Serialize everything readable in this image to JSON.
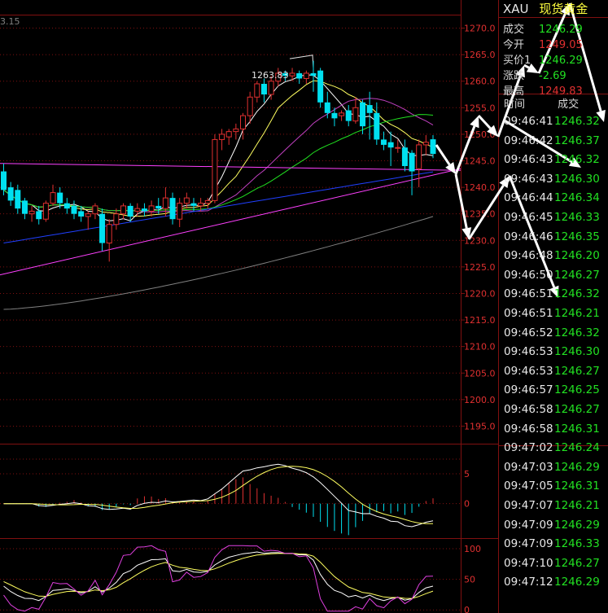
{
  "header": {
    "symbol": "XAU",
    "name": "现货黄金",
    "left_value": "3.15"
  },
  "quote": [
    {
      "label": "成交",
      "value": "1246.29",
      "color": "#22e022"
    },
    {
      "label": "今开",
      "value": "1249.05",
      "color": "#e03030"
    },
    {
      "label": "买价1",
      "value": "1246.29",
      "color": "#22e022"
    },
    {
      "label": "涨跌",
      "value": "-2.69",
      "color": "#22e022"
    },
    {
      "label": "最高",
      "value": "1249.83",
      "color": "#e03030"
    }
  ],
  "ticks_header": {
    "time": "时间",
    "price": "成交"
  },
  "ticks": [
    {
      "time": "09:46:41",
      "price": "1246.32"
    },
    {
      "time": "09:46:42",
      "price": "1246.37"
    },
    {
      "time": "09:46:43",
      "price": "1246.32"
    },
    {
      "time": "09:46:43",
      "price": "1246.30"
    },
    {
      "time": "09:46:44",
      "price": "1246.34"
    },
    {
      "time": "09:46:45",
      "price": "1246.33"
    },
    {
      "time": "09:46:46",
      "price": "1246.35"
    },
    {
      "time": "09:46:48",
      "price": "1246.20"
    },
    {
      "time": "09:46:50",
      "price": "1246.27"
    },
    {
      "time": "09:46:51",
      "price": "1246.32"
    },
    {
      "time": "09:46:51",
      "price": "1246.21"
    },
    {
      "time": "09:46:52",
      "price": "1246.32"
    },
    {
      "time": "09:46:53",
      "price": "1246.30"
    },
    {
      "time": "09:46:53",
      "price": "1246.27"
    },
    {
      "time": "09:46:57",
      "price": "1246.25"
    },
    {
      "time": "09:46:58",
      "price": "1246.27"
    },
    {
      "time": "09:46:58",
      "price": "1246.31"
    },
    {
      "time": "09:47:02",
      "price": "1246.24"
    },
    {
      "time": "09:47:03",
      "price": "1246.29"
    },
    {
      "time": "09:47:05",
      "price": "1246.31"
    },
    {
      "time": "09:47:07",
      "price": "1246.21"
    },
    {
      "time": "09:47:09",
      "price": "1246.29"
    },
    {
      "time": "09:47:09",
      "price": "1246.33"
    },
    {
      "time": "09:47:10",
      "price": "1246.27"
    },
    {
      "time": "09:47:12",
      "price": "1246.29"
    }
  ],
  "colors": {
    "up": "#e03030",
    "down": "#00e0f0",
    "ma5": "#ffffff",
    "ma10": "#ffff60",
    "ma20": "#c040c0",
    "ma30": "#20e020",
    "ma60": "#2040ff",
    "ma120": "#808080",
    "trend": "#ff40ff",
    "grid": "#801010"
  },
  "chart_data": [
    {
      "type": "candlestick",
      "title": "",
      "ylim": [
        1192,
        1271
      ],
      "yticks": [
        "1270.0",
        "1265.0",
        "1260.0",
        "1255.0",
        "1250.0",
        "1245.0",
        "1240.0",
        "1235.0",
        "1230.0",
        "1225.0",
        "1220.0",
        "1215.0",
        "1210.0",
        "1205.0",
        "1200.0",
        "1195.0"
      ],
      "high_label": "1263.83",
      "high_value": 1263.83,
      "candles": [
        {
          "o": 1243.0,
          "h": 1244.5,
          "c": 1239.5,
          "l": 1238.5
        },
        {
          "o": 1240.0,
          "h": 1241.0,
          "c": 1237.5,
          "l": 1236.5
        },
        {
          "o": 1239.5,
          "h": 1240.5,
          "c": 1236.0,
          "l": 1235.0
        },
        {
          "o": 1237.5,
          "h": 1238.0,
          "c": 1235.0,
          "l": 1234.0
        },
        {
          "o": 1235.0,
          "h": 1236.5,
          "c": 1235.5,
          "l": 1233.5
        },
        {
          "o": 1235.5,
          "h": 1236.5,
          "c": 1234.0,
          "l": 1233.0
        },
        {
          "o": 1234.0,
          "h": 1237.5,
          "c": 1237.0,
          "l": 1233.5
        },
        {
          "o": 1237.0,
          "h": 1240.5,
          "c": 1239.0,
          "l": 1236.5
        },
        {
          "o": 1239.0,
          "h": 1240.0,
          "c": 1237.0,
          "l": 1236.0
        },
        {
          "o": 1237.0,
          "h": 1238.0,
          "c": 1236.0,
          "l": 1235.0
        },
        {
          "o": 1236.5,
          "h": 1237.5,
          "c": 1235.0,
          "l": 1234.0
        },
        {
          "o": 1235.5,
          "h": 1236.5,
          "c": 1234.5,
          "l": 1233.5
        },
        {
          "o": 1234.5,
          "h": 1235.5,
          "c": 1235.0,
          "l": 1232.0
        },
        {
          "o": 1235.0,
          "h": 1237.0,
          "c": 1236.5,
          "l": 1234.0
        },
        {
          "o": 1235.0,
          "h": 1236.0,
          "c": 1229.5,
          "l": 1228.0
        },
        {
          "o": 1229.5,
          "h": 1234.0,
          "c": 1233.0,
          "l": 1226.0
        },
        {
          "o": 1233.0,
          "h": 1236.0,
          "c": 1235.0,
          "l": 1232.0
        },
        {
          "o": 1235.0,
          "h": 1237.0,
          "c": 1236.5,
          "l": 1234.0
        },
        {
          "o": 1236.5,
          "h": 1237.0,
          "c": 1234.5,
          "l": 1233.5
        },
        {
          "o": 1235.5,
          "h": 1237.0,
          "c": 1236.0,
          "l": 1234.5
        },
        {
          "o": 1236.0,
          "h": 1237.0,
          "c": 1235.5,
          "l": 1234.5
        },
        {
          "o": 1235.5,
          "h": 1237.5,
          "c": 1236.5,
          "l": 1234.5
        },
        {
          "o": 1236.5,
          "h": 1238.0,
          "c": 1236.0,
          "l": 1235.0
        },
        {
          "o": 1236.0,
          "h": 1240.0,
          "c": 1238.0,
          "l": 1234.5
        },
        {
          "o": 1238.0,
          "h": 1239.0,
          "c": 1234.0,
          "l": 1233.0
        },
        {
          "o": 1234.0,
          "h": 1238.0,
          "c": 1237.0,
          "l": 1232.5
        },
        {
          "o": 1237.0,
          "h": 1239.0,
          "c": 1238.0,
          "l": 1236.0
        },
        {
          "o": 1237.0,
          "h": 1238.0,
          "c": 1236.5,
          "l": 1235.5
        },
        {
          "o": 1236.5,
          "h": 1238.0,
          "c": 1237.0,
          "l": 1235.5
        },
        {
          "o": 1237.0,
          "h": 1238.0,
          "c": 1237.5,
          "l": 1236.0
        },
        {
          "o": 1237.5,
          "h": 1250.0,
          "c": 1249.0,
          "l": 1237.0
        },
        {
          "o": 1249.0,
          "h": 1251.0,
          "c": 1250.0,
          "l": 1247.0
        },
        {
          "o": 1249.5,
          "h": 1251.0,
          "c": 1250.5,
          "l": 1248.0
        },
        {
          "o": 1250.5,
          "h": 1252.0,
          "c": 1251.0,
          "l": 1249.0
        },
        {
          "o": 1251.0,
          "h": 1254.0,
          "c": 1253.5,
          "l": 1249.0
        },
        {
          "o": 1253.5,
          "h": 1258.0,
          "c": 1257.0,
          "l": 1252.0
        },
        {
          "o": 1257.0,
          "h": 1260.0,
          "c": 1259.5,
          "l": 1256.0
        },
        {
          "o": 1259.5,
          "h": 1260.5,
          "c": 1257.5,
          "l": 1256.0
        },
        {
          "o": 1257.5,
          "h": 1261.0,
          "c": 1260.0,
          "l": 1256.5
        },
        {
          "o": 1260.0,
          "h": 1262.5,
          "c": 1261.5,
          "l": 1259.0
        },
        {
          "o": 1261.5,
          "h": 1262.0,
          "c": 1261.0,
          "l": 1260.0
        },
        {
          "o": 1261.0,
          "h": 1262.5,
          "c": 1261.5,
          "l": 1260.0
        },
        {
          "o": 1261.5,
          "h": 1262.0,
          "c": 1260.5,
          "l": 1259.5
        },
        {
          "o": 1260.5,
          "h": 1262.0,
          "c": 1261.5,
          "l": 1259.5
        },
        {
          "o": 1261.5,
          "h": 1263.83,
          "c": 1261.0,
          "l": 1258.0
        },
        {
          "o": 1262.0,
          "h": 1262.5,
          "c": 1256.0,
          "l": 1255.0
        },
        {
          "o": 1256.0,
          "h": 1258.0,
          "c": 1254.0,
          "l": 1253.0
        },
        {
          "o": 1254.0,
          "h": 1255.0,
          "c": 1253.0,
          "l": 1251.5
        },
        {
          "o": 1253.5,
          "h": 1254.5,
          "c": 1254.0,
          "l": 1252.5
        },
        {
          "o": 1254.5,
          "h": 1255.5,
          "c": 1252.5,
          "l": 1251.5
        },
        {
          "o": 1252.5,
          "h": 1257.0,
          "c": 1255.0,
          "l": 1252.0
        },
        {
          "o": 1256.0,
          "h": 1256.5,
          "c": 1251.5,
          "l": 1250.0
        },
        {
          "o": 1255.5,
          "h": 1258.0,
          "c": 1254.0,
          "l": 1249.0
        },
        {
          "o": 1254.0,
          "h": 1256.0,
          "c": 1249.0,
          "l": 1248.0
        },
        {
          "o": 1249.0,
          "h": 1250.5,
          "c": 1248.0,
          "l": 1247.0
        },
        {
          "o": 1248.5,
          "h": 1250.5,
          "c": 1247.5,
          "l": 1244.0
        },
        {
          "o": 1247.5,
          "h": 1249.0,
          "c": 1247.5,
          "l": 1246.5
        },
        {
          "o": 1247.5,
          "h": 1249.0,
          "c": 1244.0,
          "l": 1243.0
        },
        {
          "o": 1246.5,
          "h": 1247.0,
          "c": 1243.0,
          "l": 1238.5
        },
        {
          "o": 1243.5,
          "h": 1249.0,
          "c": 1248.0,
          "l": 1240.0
        },
        {
          "o": 1248.0,
          "h": 1249.83,
          "c": 1248.5,
          "l": 1246.0
        },
        {
          "o": 1249.05,
          "h": 1249.83,
          "c": 1246.29,
          "l": 1245.5
        }
      ]
    },
    {
      "type": "bar",
      "title": "",
      "yticks": [
        "5",
        "0"
      ],
      "ylim": [
        -4,
        8
      ]
    },
    {
      "type": "line",
      "title": "",
      "yticks": [
        "100",
        "50",
        "0"
      ],
      "ylim": [
        -5,
        108
      ]
    }
  ]
}
